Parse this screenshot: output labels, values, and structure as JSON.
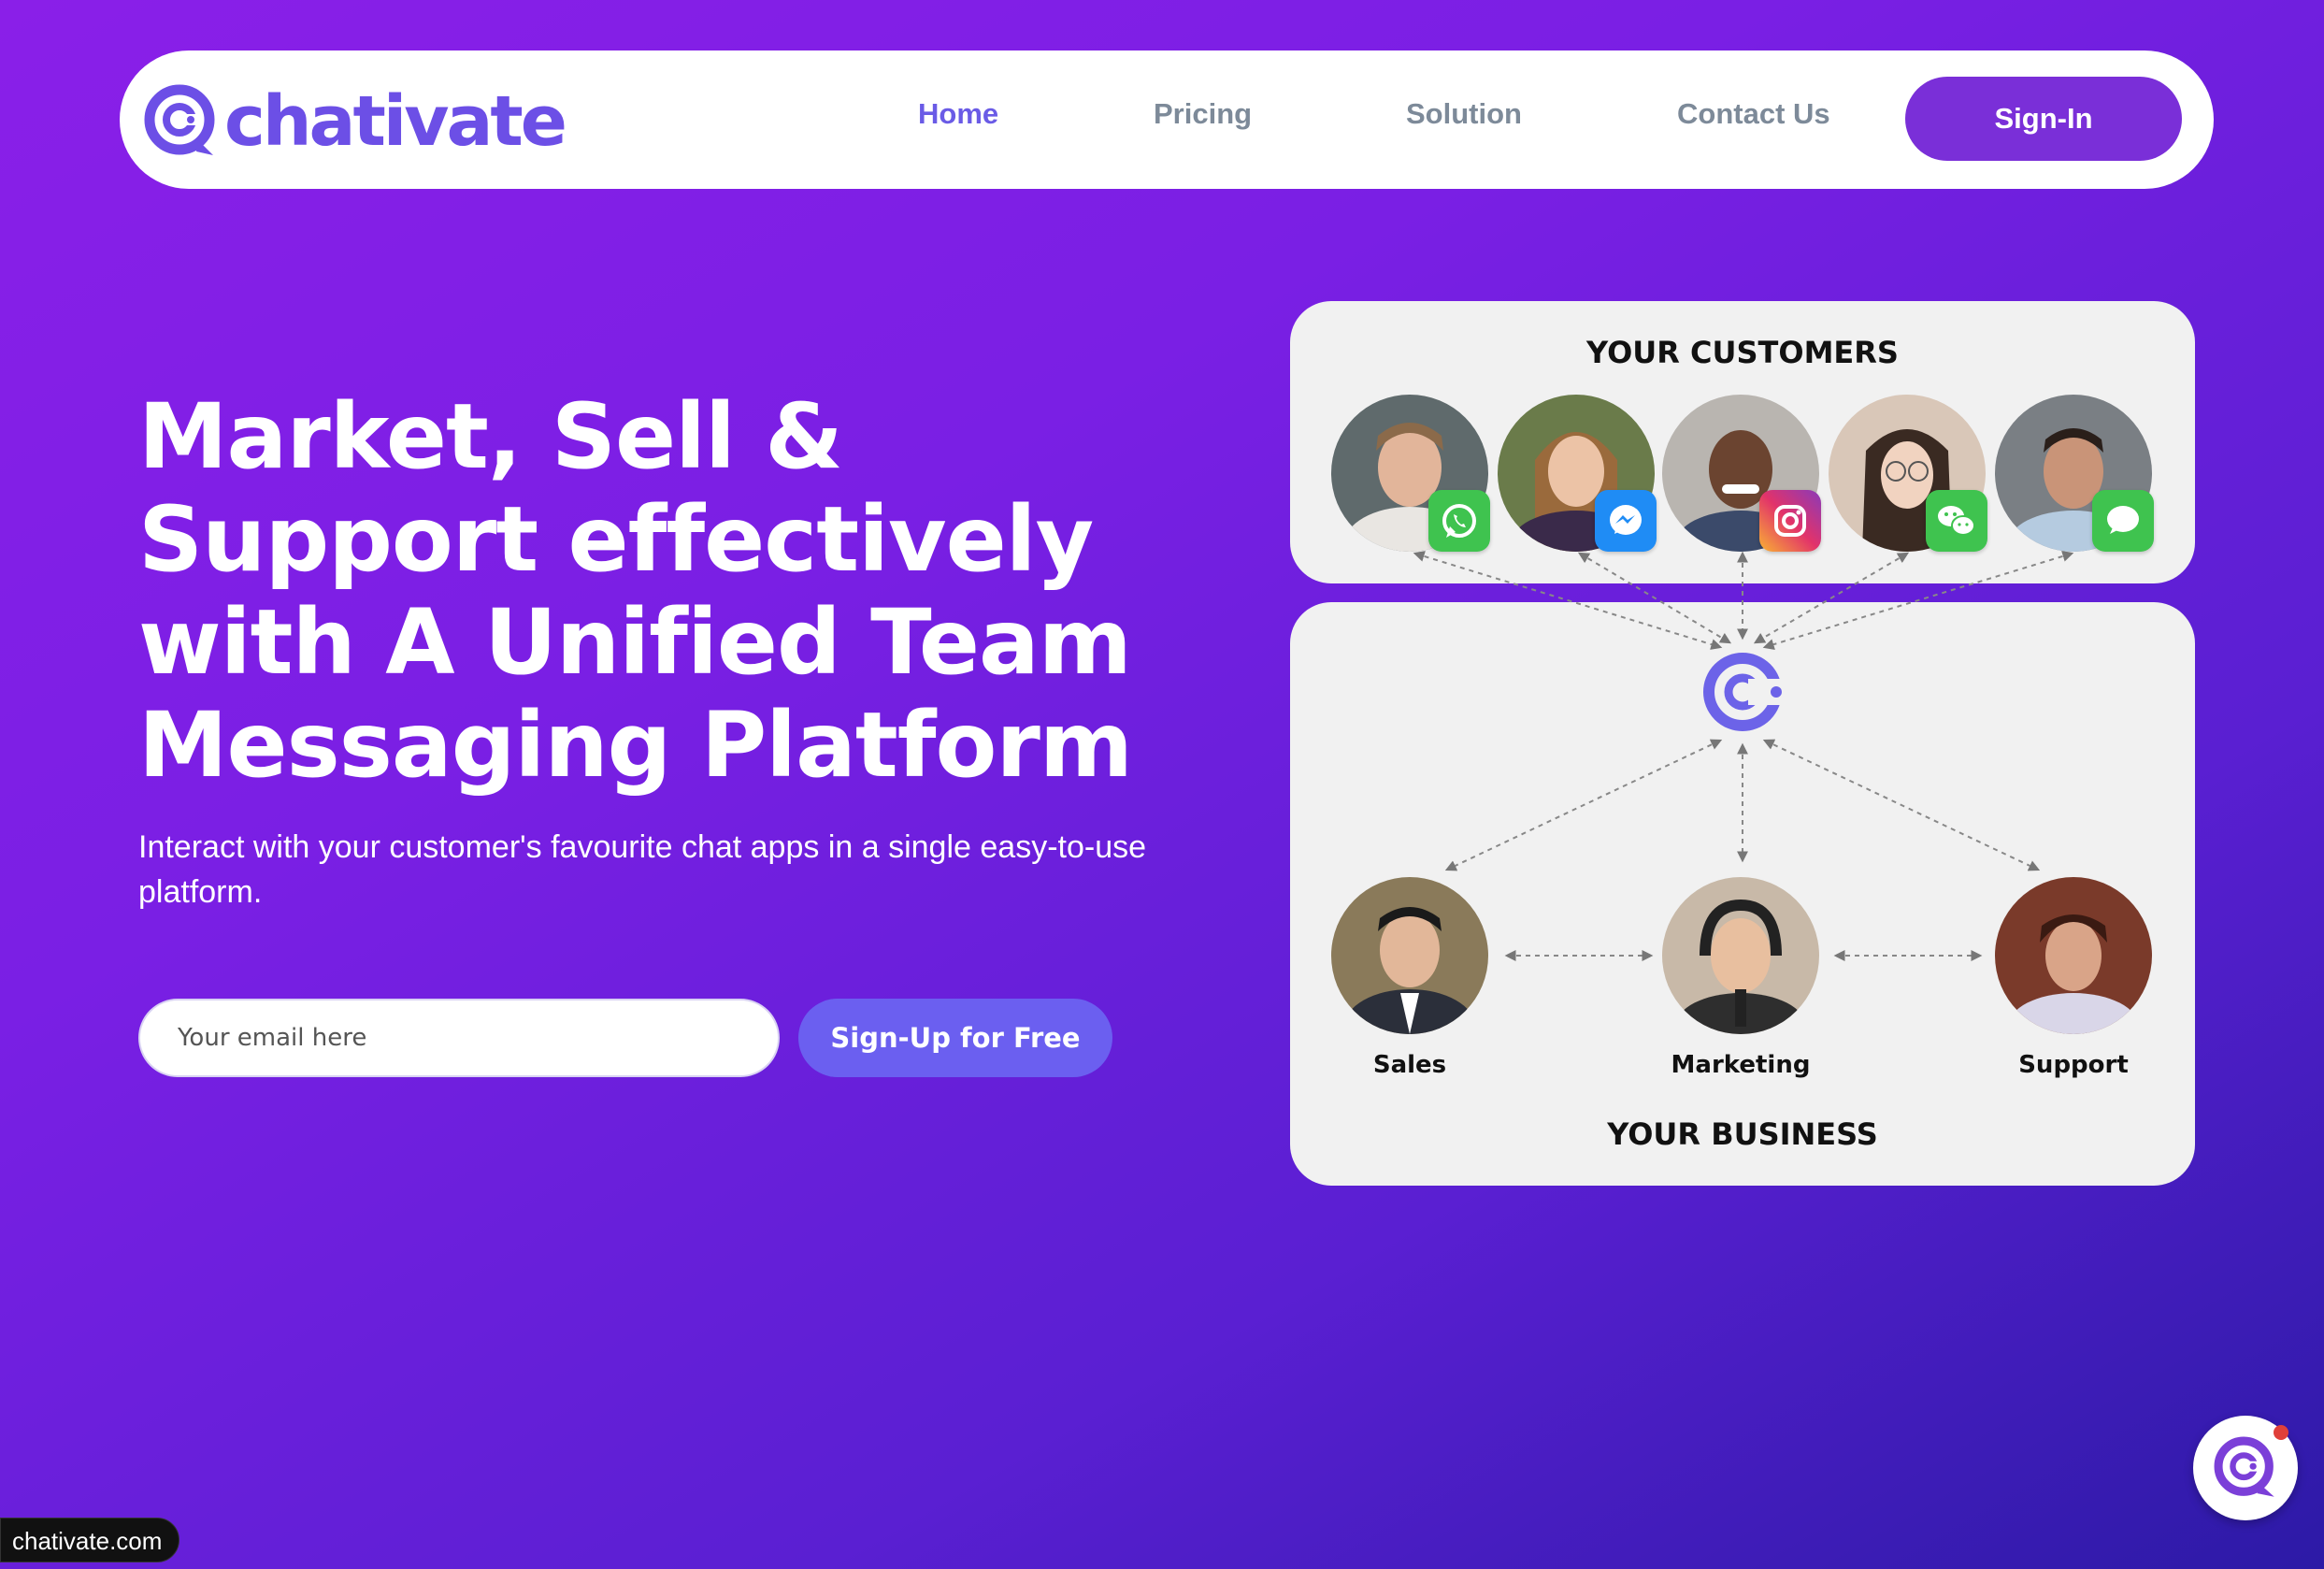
{
  "brand": {
    "name": "chativate",
    "color": "#6c4fe6"
  },
  "nav": {
    "links": [
      {
        "label": "Home",
        "active": true
      },
      {
        "label": "Pricing",
        "active": false
      },
      {
        "label": "Solution",
        "active": false
      },
      {
        "label": "Contact Us",
        "active": false
      }
    ],
    "signin_label": "Sign-In"
  },
  "hero": {
    "title": "Market, Sell & Support effectively with A Unified Team Messaging Platform",
    "subtitle": "Interact with your customer's favourite chat apps in a single easy-to-use platform.",
    "email_placeholder": "Your email here",
    "signup_label": "Sign-Up for Free"
  },
  "diagram": {
    "customers_title": "YOUR CUSTOMERS",
    "business_title": "YOUR BUSINESS",
    "customers": [
      {
        "app": "whatsapp-icon",
        "app_color": "#3fc34f"
      },
      {
        "app": "messenger-icon",
        "app_color": "#1f8cf5"
      },
      {
        "app": "instagram-icon",
        "app_color": "#d62e80"
      },
      {
        "app": "wechat-icon",
        "app_color": "#3fc34f"
      },
      {
        "app": "imessage-icon",
        "app_color": "#3fc34f"
      }
    ],
    "team": [
      {
        "label": "Sales"
      },
      {
        "label": "Marketing"
      },
      {
        "label": "Support"
      }
    ]
  },
  "footer": {
    "url": "chativate.com"
  }
}
